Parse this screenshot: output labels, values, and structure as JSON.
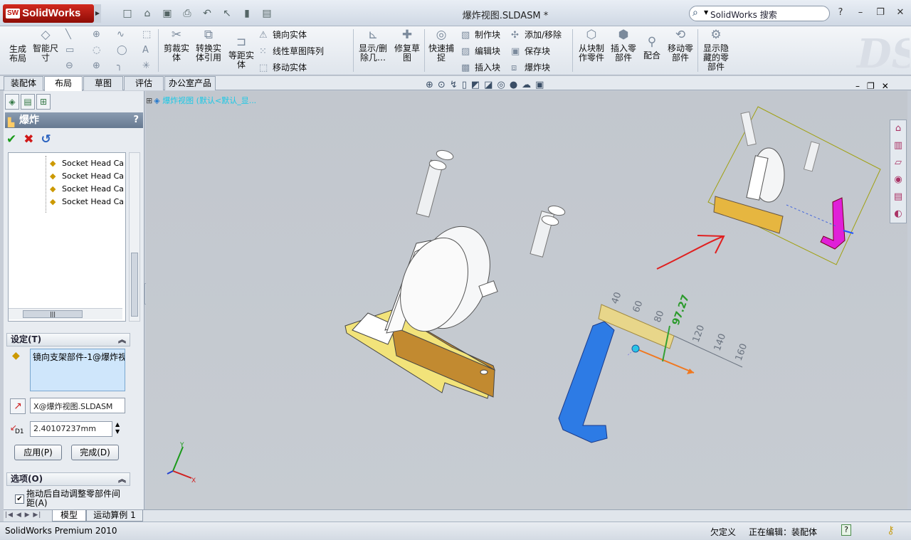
{
  "app": {
    "logo": "SolidWorks",
    "logo_mark": "SW",
    "title": "爆炸视图.SLDASM *",
    "search_placeholder": "SolidWorks 搜索"
  },
  "ribbon": {
    "big_buttons": [
      {
        "label": "生成\n布局",
        "icon": "layout-icon"
      },
      {
        "label": "智能尺\n寸",
        "icon": "smart-dimension-icon"
      },
      {
        "label": "剪裁实\n体",
        "icon": "trim-icon"
      },
      {
        "label": "转换实\n体引用",
        "icon": "convert-icon"
      },
      {
        "label": "等距实\n体",
        "icon": "offset-icon"
      },
      {
        "label": "显示/删\n除几…",
        "icon": "relations-icon"
      },
      {
        "label": "修复草\n图",
        "icon": "repair-icon"
      },
      {
        "label": "快速捕\n捉",
        "icon": "snap-icon"
      },
      {
        "label": "从块制\n作零件",
        "icon": "block-part-icon"
      },
      {
        "label": "插入零\n部件",
        "icon": "insert-component-icon"
      },
      {
        "label": "配合",
        "icon": "mate-icon"
      },
      {
        "label": "移动零\n部件",
        "icon": "move-component-icon"
      },
      {
        "label": "显示隐\n藏的零\n部件",
        "icon": "show-hidden-icon"
      }
    ],
    "small_buttons": [
      {
        "label": "镜向实体"
      },
      {
        "label": "线性草图阵列"
      },
      {
        "label": "移动实体"
      },
      {
        "label": "制作块"
      },
      {
        "label": "编辑块"
      },
      {
        "label": "插入块"
      },
      {
        "label": "添加/移除"
      },
      {
        "label": "保存块"
      },
      {
        "label": "爆炸块"
      }
    ]
  },
  "tabs": [
    "装配体",
    "布局",
    "草图",
    "评估",
    "办公室产品"
  ],
  "active_tab": "布局",
  "panel": {
    "title": "爆炸",
    "help": "?",
    "tree_items": [
      "Socket Head Ca",
      "Socket Head Ca",
      "Socket Head Ca",
      "Socket Head Ca"
    ],
    "settings_header": "设定(T)",
    "selection": "镜向支架部件-1@爆炸视",
    "direction": "X@爆炸视图.SLDASM",
    "distance": "2.40107237mm",
    "distance_symbol": "D1",
    "apply": "应用(P)",
    "done": "完成(D)",
    "options_header": "选项(O)",
    "auto_space": "拖动后自动调整零部件间距(A)"
  },
  "viewport": {
    "breadcrumb": "爆炸视图 (默认<默认_显...",
    "ruler_ticks": [
      "40",
      "60",
      "80",
      "120",
      "140",
      "160"
    ],
    "ruler_value": "97.27",
    "triad_labels": [
      "Y",
      "X"
    ]
  },
  "bottom_tabs": [
    "模型",
    "运动算例 1"
  ],
  "status": {
    "product": "SolidWorks Premium 2010",
    "underdefined": "欠定义",
    "editing": "正在编辑：装配体",
    "help": "?"
  },
  "colors": {
    "accent_blue": "#2d7be5",
    "part_yellow": "#f2e37a",
    "part_magenta": "#e020d8",
    "arrow_red": "#e02020"
  }
}
